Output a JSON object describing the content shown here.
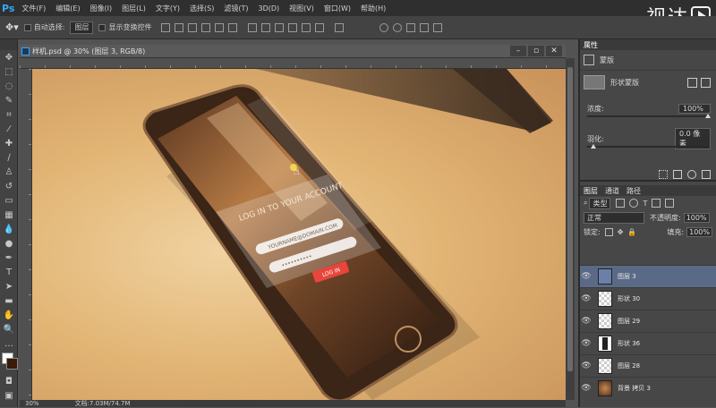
{
  "app": {
    "logo": "Ps"
  },
  "menu": [
    "文件(F)",
    "编辑(E)",
    "图像(I)",
    "图层(L)",
    "文字(Y)",
    "选择(S)",
    "滤镜(T)",
    "3D(D)",
    "视图(V)",
    "窗口(W)",
    "帮助(H)"
  ],
  "watermark": {
    "text": "视达"
  },
  "options_bar": {
    "auto_select_label": "自动选择:",
    "auto_select_value": "图层",
    "show_transform_label": "显示变换控件"
  },
  "document": {
    "tab_title": "样机.psd @ 30% (图层 3, RGB/8)"
  },
  "canvas_screen": {
    "heading": "LOG IN TO YOUR ACCOUNT",
    "username_placeholder": "YOURNAME@DOMAIN.COM",
    "password_placeholder": "••••••••••",
    "login_button": "LOG IN"
  },
  "status": {
    "zoom": "30%",
    "doc_size": "文档:7.03M/74.7M"
  },
  "properties_panel": {
    "tab": "属性",
    "title": "蒙版",
    "mask_label": "形状蒙版",
    "density_label": "浓度:",
    "density_value": "100%",
    "feather_label": "羽化:",
    "feather_value": "0.0 像素"
  },
  "layers_panel": {
    "tabs": [
      "图层",
      "通道",
      "路径"
    ],
    "kind_label": "类型",
    "blend_mode": "正常",
    "opacity_label": "不透明度:",
    "opacity_value": "100%",
    "lock_label": "锁定:",
    "fill_label": "填充:",
    "fill_value": "100%",
    "layers": [
      {
        "name": "图层 3",
        "thumb": "blue",
        "selected": true
      },
      {
        "name": "形状 30",
        "thumb": "checker",
        "selected": false
      },
      {
        "name": "图层 29",
        "thumb": "checker",
        "selected": false
      },
      {
        "name": "形状 36",
        "thumb": "dark",
        "selected": false
      },
      {
        "name": "图层 28",
        "thumb": "checker",
        "selected": false
      },
      {
        "name": "背景 拷贝 3",
        "thumb": "photo",
        "selected": false
      }
    ]
  },
  "colors": {
    "accent_red": "#e8453c",
    "selection_blue": "#5a6a86",
    "ps_blue": "#31a8ff"
  }
}
